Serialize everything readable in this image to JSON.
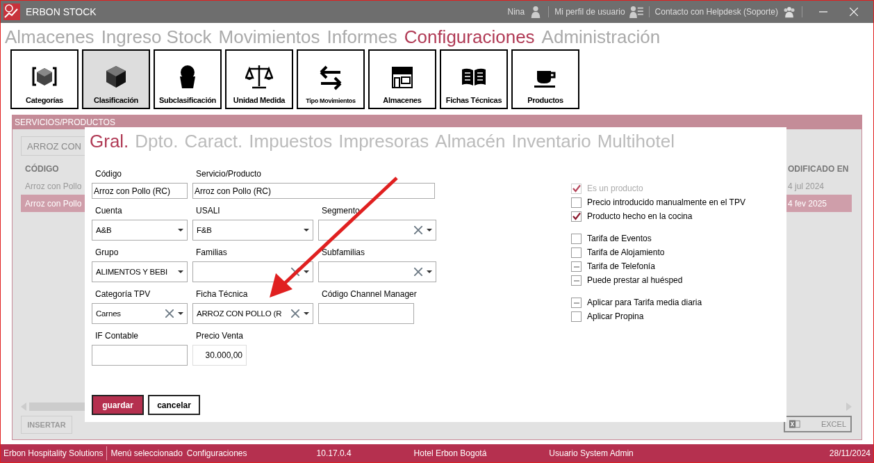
{
  "window": {
    "title": "ERBON STOCK",
    "user": "Nina",
    "profile_link": "Mi perfil de usuario",
    "helpdesk_link": "Contacto con Helpdesk (Soporte)"
  },
  "main_menu": [
    {
      "label": "Almacenes",
      "selected": false
    },
    {
      "label": "Ingreso Stock",
      "selected": false
    },
    {
      "label": "Movimientos",
      "selected": false
    },
    {
      "label": "Informes",
      "selected": false
    },
    {
      "label": "Configuraciones",
      "selected": true
    },
    {
      "label": "Administración",
      "selected": false
    }
  ],
  "toolbar": [
    {
      "label": "Categorías",
      "kind": "cube-frame",
      "selected": false
    },
    {
      "label": "Clasificación",
      "kind": "cube",
      "selected": true
    },
    {
      "label": "Subclasificación",
      "kind": "cupcake",
      "selected": false
    },
    {
      "label": "Unidad Medida",
      "kind": "scale",
      "selected": false
    },
    {
      "label": "Tipo Movimientos",
      "kind": "arrows",
      "selected": false
    },
    {
      "label": "Almacenes",
      "kind": "store",
      "selected": false
    },
    {
      "label": "Fichas Técnicas",
      "kind": "book",
      "selected": false
    },
    {
      "label": "Productos",
      "kind": "cup",
      "selected": false
    }
  ],
  "panel": {
    "title": "SERVICIOS/PRODUCTOS",
    "search_value": "ARROZ CON",
    "columns": [
      "CÓDIGO",
      "ODIFICADO EN"
    ],
    "rows": [
      {
        "cells": [
          "Arroz con Pollo",
          "4 jul 2024"
        ],
        "selected": false
      },
      {
        "cells": [
          "Arroz con Pollo",
          "4 fev 2025"
        ],
        "selected": true
      }
    ],
    "buttons": [
      "INSERTAR"
    ],
    "excel_button": "EXCEL"
  },
  "dialog": {
    "tabs": [
      {
        "label": "Gral.",
        "selected": true
      },
      {
        "label": "Dpto.",
        "selected": false
      },
      {
        "label": "Caract.",
        "selected": false
      },
      {
        "label": "Impuestos",
        "selected": false
      },
      {
        "label": "Impresoras",
        "selected": false
      },
      {
        "label": "Almacén",
        "selected": false
      },
      {
        "label": "Inventario",
        "selected": false
      },
      {
        "label": "Multihotel",
        "selected": false
      }
    ],
    "field_rows": [
      [
        {
          "label": "Código",
          "kind": "text",
          "value": "Arroz con Pollo (RC)"
        },
        {
          "label": "Servicio/Producto",
          "kind": "text",
          "value": "Arroz con Pollo (RC)"
        }
      ],
      [
        {
          "label": "Cuenta",
          "kind": "select",
          "value": "A&B",
          "clearable": false
        },
        {
          "label": "USALI",
          "kind": "select",
          "value": "F&B",
          "clearable": false
        },
        {
          "label": "Segmento",
          "kind": "select",
          "clearable": true
        }
      ],
      [
        {
          "label": "Grupo",
          "kind": "select",
          "value": "ALIMENTOS Y BEBI",
          "clearable": false
        },
        {
          "label": "Familias",
          "kind": "select",
          "clearable": true
        },
        {
          "label": "Subfamilias",
          "kind": "select",
          "clearable": true
        }
      ],
      [
        {
          "label": "Categoría TPV",
          "kind": "select",
          "value": "Carnes",
          "clearable": true
        },
        {
          "label": "Ficha Técnica",
          "kind": "select",
          "value": "ARROZ CON POLLO (R",
          "clearable": true
        },
        {
          "label": "Código Channel Manager",
          "kind": "text"
        }
      ],
      [
        {
          "label": "IF Contable",
          "kind": "text"
        },
        {
          "label": "Precio Venta",
          "kind": "number",
          "value": "30.000,00"
        }
      ]
    ],
    "checkbox_groups": [
      [
        {
          "label": "Es un producto",
          "checked": true,
          "disabled": true
        },
        {
          "label": "Precio introducido manualmente en el TPV",
          "checked": false,
          "disabled": false
        },
        {
          "label": "Producto hecho en la cocina",
          "checked": true,
          "disabled": false
        }
      ],
      [
        {
          "label": "Tarifa de Eventos",
          "checked": false,
          "disabled": false
        },
        {
          "label": "Tarifa de Alojamiento",
          "checked": false,
          "disabled": false
        },
        {
          "label": "Tarifa de Telefonía",
          "indeterminate": true,
          "disabled": false
        },
        {
          "label": "Puede prestar al huésped",
          "indeterminate": true,
          "disabled": false
        }
      ],
      [
        {
          "label": "Aplicar para Tarifa media diaria",
          "indeterminate": true,
          "disabled": false
        },
        {
          "label": "Aplicar Propina",
          "checked": false,
          "disabled": false
        }
      ]
    ],
    "save_button": "guardar",
    "cancel_button": "cancelar"
  },
  "status_bar": {
    "company": "Erbon Hospitality Solutions",
    "menu_label": "Menú seleccionado",
    "menu_value": "Configuraciones",
    "version": "10.17.0.4",
    "hotel": "Hotel Erbon Bogotá",
    "user": "Usuario System Admin",
    "date": "28/11/2024"
  }
}
